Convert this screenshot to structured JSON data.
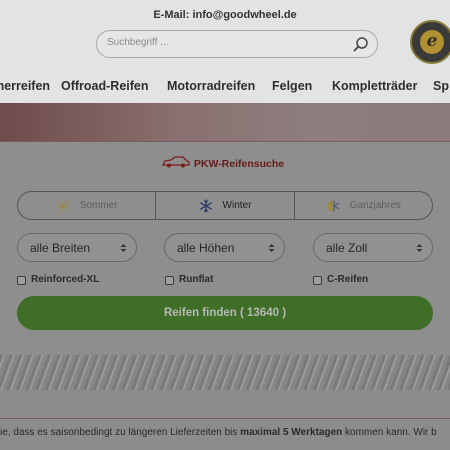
{
  "header": {
    "email": "E-Mail: info@goodwheel.de",
    "search_placeholder": "Suchbegriff ..."
  },
  "nav": {
    "items": [
      "Sommerreifen",
      "Offroad-Reifen",
      "Motorradreifen",
      "Felgen",
      "Kompletträder",
      "Sp"
    ]
  },
  "search_panel": {
    "title": "PKW-Reifensuche",
    "seasons": [
      {
        "label": "Sommer",
        "icon": "sun-icon",
        "active": false
      },
      {
        "label": "Winter",
        "icon": "snowflake-icon",
        "active": true
      },
      {
        "label": "Ganzjahres",
        "icon": "sun-snowflake-icon",
        "active": false
      }
    ],
    "selects": {
      "width": "alle Breiten",
      "height": "alle Höhen",
      "rim": "alle Zoll"
    },
    "checkboxes": {
      "reinforced": "Reinforced-XL",
      "runflat": "Runflat",
      "c_tires": "C-Reifen"
    },
    "find_button": "Reifen finden ( 13640 )"
  },
  "notice": {
    "prefix": "ie, dass es saisonbedingt zu längeren Lieferzeiten bis ",
    "bold": "maximal 5 Werktagen",
    "suffix": " kommen kann. Wir b"
  },
  "colors": {
    "overlay_bg": "#8c8c8c",
    "button_green": "#3f6e27",
    "title_red": "#6a1818"
  }
}
